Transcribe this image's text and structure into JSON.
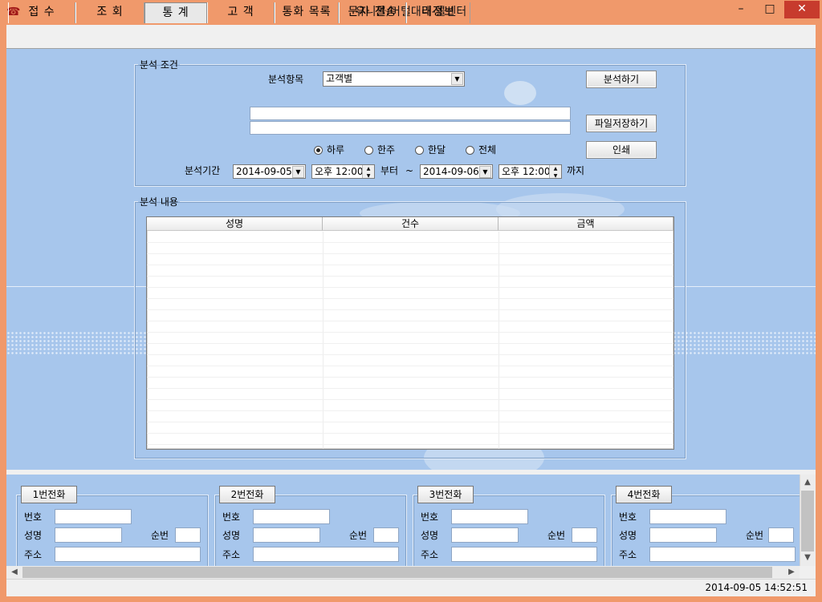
{
  "window": {
    "title": "유니콜/머털대리-콜센터",
    "app_icon": "phone-icon"
  },
  "tabs": [
    {
      "label": "접 수"
    },
    {
      "label": "조 회"
    },
    {
      "label": "통 계",
      "active": true
    },
    {
      "label": "고 객"
    },
    {
      "label": "통화 목록"
    },
    {
      "label": "문자 전송"
    },
    {
      "label": "내정보"
    }
  ],
  "analysis_condition": {
    "legend": "분석 조건",
    "item_label": "분석항목",
    "item_value": "고객별",
    "analyze_button": "분석하기",
    "save_file_button": "파일저장하기",
    "print_button": "인쇄",
    "period_options": [
      "하루",
      "한주",
      "한달",
      "전체"
    ],
    "period_selected": "하루",
    "period_label": "분석기간",
    "start_date": "2014-09-05",
    "start_time": "오후 12:00",
    "from_label": "부터",
    "tilde": "~",
    "end_date": "2014-09-06",
    "end_time": "오후 12:00",
    "until_label": "까지"
  },
  "analysis_content": {
    "legend": "분석 내용",
    "columns": [
      "성명",
      "건수",
      "금액"
    ]
  },
  "phones": [
    {
      "tab": "1번전화",
      "number_label": "번호",
      "name_label": "성명",
      "order_label": "순번",
      "address_label": "주소"
    },
    {
      "tab": "2번전화",
      "number_label": "번호",
      "name_label": "성명",
      "order_label": "순번",
      "address_label": "주소"
    },
    {
      "tab": "3번전화",
      "number_label": "번호",
      "name_label": "성명",
      "order_label": "순번",
      "address_label": "주소"
    },
    {
      "tab": "4번전화",
      "number_label": "번호",
      "name_label": "성명",
      "order_label": "순번",
      "address_label": "주소"
    }
  ],
  "status": {
    "datetime": "2014-09-05 14:52:51"
  },
  "colors": {
    "titlebar": "#f0996b",
    "panel_bg": "#a7c6ec",
    "close_button": "#c73b2d"
  }
}
